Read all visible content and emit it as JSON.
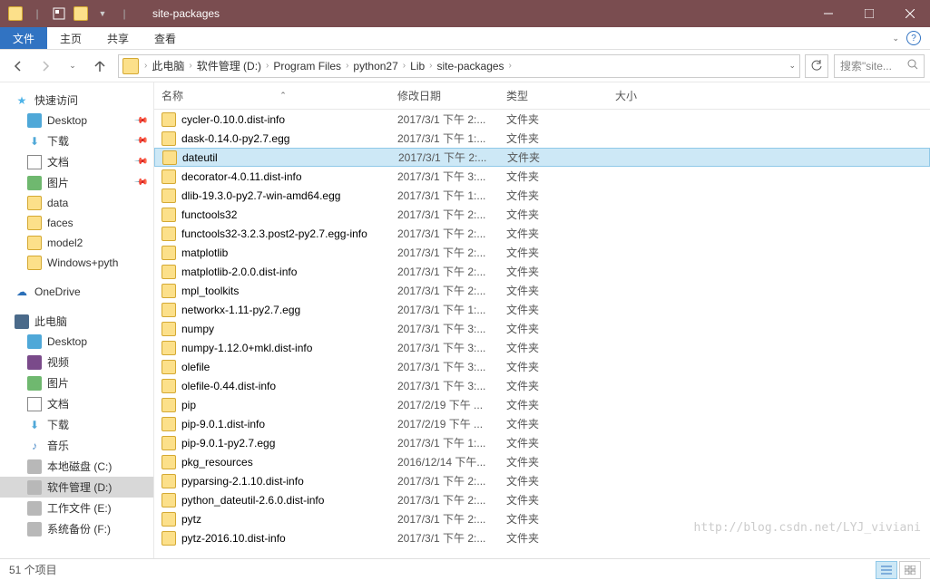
{
  "window": {
    "title": "site-packages"
  },
  "ribbon": {
    "file": "文件",
    "tabs": [
      "主页",
      "共享",
      "查看"
    ]
  },
  "nav": {
    "crumbs": [
      "此电脑",
      "软件管理 (D:)",
      "Program Files",
      "python27",
      "Lib",
      "site-packages"
    ],
    "search_placeholder": "搜索\"site..."
  },
  "sidebar": {
    "quick_access": {
      "label": "快速访问",
      "items": [
        {
          "label": "Desktop",
          "pinned": true,
          "icon": "desktop"
        },
        {
          "label": "下载",
          "pinned": true,
          "icon": "download"
        },
        {
          "label": "文档",
          "pinned": true,
          "icon": "doc"
        },
        {
          "label": "图片",
          "pinned": true,
          "icon": "pic"
        },
        {
          "label": "data",
          "pinned": false,
          "icon": "folder"
        },
        {
          "label": "faces",
          "pinned": false,
          "icon": "folder"
        },
        {
          "label": "model2",
          "pinned": false,
          "icon": "folder"
        },
        {
          "label": "Windows+pyth",
          "pinned": false,
          "icon": "folder"
        }
      ]
    },
    "onedrive": {
      "label": "OneDrive"
    },
    "this_pc": {
      "label": "此电脑",
      "items": [
        {
          "label": "Desktop",
          "icon": "desktop"
        },
        {
          "label": "视频",
          "icon": "video"
        },
        {
          "label": "图片",
          "icon": "pic"
        },
        {
          "label": "文档",
          "icon": "doc"
        },
        {
          "label": "下载",
          "icon": "download"
        },
        {
          "label": "音乐",
          "icon": "music"
        },
        {
          "label": "本地磁盘 (C:)",
          "icon": "drive"
        },
        {
          "label": "软件管理 (D:)",
          "icon": "drive",
          "selected": true
        },
        {
          "label": "工作文件 (E:)",
          "icon": "drive"
        },
        {
          "label": "系统备份 (F:)",
          "icon": "drive"
        }
      ]
    }
  },
  "columns": {
    "name": "名称",
    "date": "修改日期",
    "type": "类型",
    "size": "大小"
  },
  "files": [
    {
      "name": "cycler-0.10.0.dist-info",
      "date": "2017/3/1 下午 2:...",
      "type": "文件夹"
    },
    {
      "name": "dask-0.14.0-py2.7.egg",
      "date": "2017/3/1 下午 1:...",
      "type": "文件夹"
    },
    {
      "name": "dateutil",
      "date": "2017/3/1 下午 2:...",
      "type": "文件夹",
      "selected": true
    },
    {
      "name": "decorator-4.0.11.dist-info",
      "date": "2017/3/1 下午 3:...",
      "type": "文件夹"
    },
    {
      "name": "dlib-19.3.0-py2.7-win-amd64.egg",
      "date": "2017/3/1 下午 1:...",
      "type": "文件夹"
    },
    {
      "name": "functools32",
      "date": "2017/3/1 下午 2:...",
      "type": "文件夹"
    },
    {
      "name": "functools32-3.2.3.post2-py2.7.egg-info",
      "date": "2017/3/1 下午 2:...",
      "type": "文件夹"
    },
    {
      "name": "matplotlib",
      "date": "2017/3/1 下午 2:...",
      "type": "文件夹"
    },
    {
      "name": "matplotlib-2.0.0.dist-info",
      "date": "2017/3/1 下午 2:...",
      "type": "文件夹"
    },
    {
      "name": "mpl_toolkits",
      "date": "2017/3/1 下午 2:...",
      "type": "文件夹"
    },
    {
      "name": "networkx-1.11-py2.7.egg",
      "date": "2017/3/1 下午 1:...",
      "type": "文件夹"
    },
    {
      "name": "numpy",
      "date": "2017/3/1 下午 3:...",
      "type": "文件夹"
    },
    {
      "name": "numpy-1.12.0+mkl.dist-info",
      "date": "2017/3/1 下午 3:...",
      "type": "文件夹"
    },
    {
      "name": "olefile",
      "date": "2017/3/1 下午 3:...",
      "type": "文件夹"
    },
    {
      "name": "olefile-0.44.dist-info",
      "date": "2017/3/1 下午 3:...",
      "type": "文件夹"
    },
    {
      "name": "pip",
      "date": "2017/2/19 下午 ...",
      "type": "文件夹"
    },
    {
      "name": "pip-9.0.1.dist-info",
      "date": "2017/2/19 下午 ...",
      "type": "文件夹"
    },
    {
      "name": "pip-9.0.1-py2.7.egg",
      "date": "2017/3/1 下午 1:...",
      "type": "文件夹"
    },
    {
      "name": "pkg_resources",
      "date": "2016/12/14 下午...",
      "type": "文件夹"
    },
    {
      "name": "pyparsing-2.1.10.dist-info",
      "date": "2017/3/1 下午 2:...",
      "type": "文件夹"
    },
    {
      "name": "python_dateutil-2.6.0.dist-info",
      "date": "2017/3/1 下午 2:...",
      "type": "文件夹"
    },
    {
      "name": "pytz",
      "date": "2017/3/1 下午 2:...",
      "type": "文件夹"
    },
    {
      "name": "pytz-2016.10.dist-info",
      "date": "2017/3/1 下午 2:...",
      "type": "文件夹"
    }
  ],
  "status": {
    "count": "51 个项目"
  },
  "watermark": "http://blog.csdn.net/LYJ_viviani"
}
